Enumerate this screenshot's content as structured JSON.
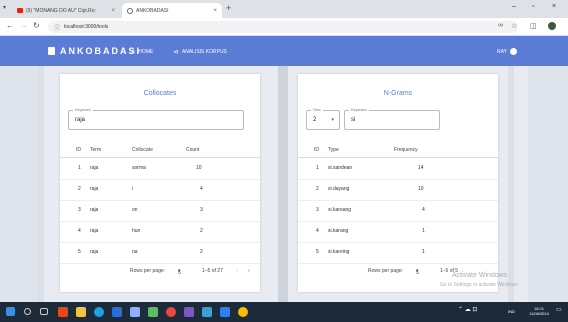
{
  "browser": {
    "tabs": [
      {
        "title": "(9) \"MONANG DO AU\" Cipt.Ro:",
        "icon": "youtube-icon"
      },
      {
        "title": "ANKOBADASI",
        "icon": "globe-icon"
      }
    ],
    "new_tab": "+",
    "url": "localhost:3000/tools"
  },
  "appbar": {
    "brand": "ANKOBADASI",
    "nav": [
      {
        "label": "HOME",
        "icon": "home-icon"
      },
      {
        "label": "ANALISIS KORPUS",
        "icon": "share-icon"
      }
    ],
    "user": "RAY",
    "color": "#5b7cd4"
  },
  "collocates": {
    "title": "Collocates",
    "keyword_label": "Keyword",
    "keyword_value": "raja",
    "headers": [
      "ID",
      "Term",
      "Collocate",
      "Count"
    ],
    "rows": [
      {
        "id": "1",
        "term": "raja",
        "collocate": "sorma",
        "count": "10"
      },
      {
        "id": "2",
        "term": "raja",
        "collocate": "i",
        "count": "4"
      },
      {
        "id": "3",
        "term": "raja",
        "collocate": "on",
        "count": "3"
      },
      {
        "id": "4",
        "term": "raja",
        "collocate": "hun",
        "count": "2"
      },
      {
        "id": "5",
        "term": "raja",
        "collocate": "na",
        "count": "2"
      }
    ],
    "pager": {
      "label": "Rows per page:",
      "per_page": "5",
      "range": "1–5 of 27"
    }
  },
  "ngrams": {
    "title": "N-Grams",
    "size_label": "Size",
    "size_value": "2",
    "keyword_label": "Keyword",
    "keyword_value": "si",
    "headers": [
      "ID",
      "Type",
      "Frequency"
    ],
    "rows": [
      {
        "id": "1",
        "type": "si.sandean",
        "freq": "14"
      },
      {
        "id": "2",
        "type": "si.dayang",
        "freq": "10"
      },
      {
        "id": "3",
        "type": "si.kareang",
        "freq": "4"
      },
      {
        "id": "4",
        "type": "si.karang",
        "freq": "1"
      },
      {
        "id": "5",
        "type": "si.kareing",
        "freq": "1"
      }
    ],
    "pager": {
      "label": "Rows per page:",
      "per_page": "5",
      "range": "1–5 of 5"
    }
  },
  "watermark": {
    "line1": "Activate Windows",
    "line2": "Go to Settings to activate Windows."
  },
  "taskbar": {
    "time": "16:21",
    "date": "11/06/2024",
    "lang": "IND"
  }
}
